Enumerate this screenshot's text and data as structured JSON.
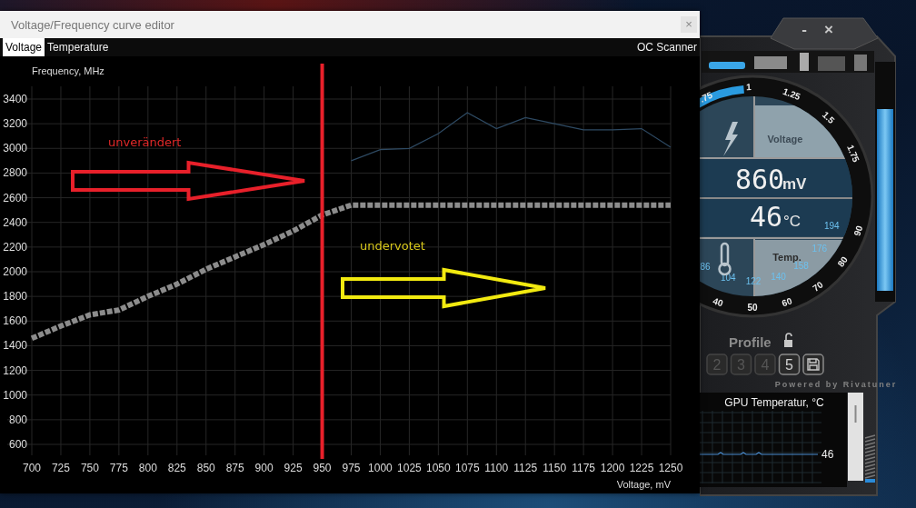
{
  "editor": {
    "title": "Voltage/Frequency curve editor",
    "close_label": "×",
    "tabs": [
      {
        "label": "Voltage",
        "selected": true
      },
      {
        "label": "Temperature",
        "selected": false
      }
    ],
    "oc_scanner": "OC Scanner",
    "chart_data": {
      "type": "line",
      "xlabel": "Voltage, mV",
      "ylabel": "Frequency, MHz",
      "x": [
        700,
        725,
        750,
        775,
        800,
        825,
        850,
        875,
        900,
        925,
        950,
        975,
        1000,
        1025,
        1050,
        1075,
        1100,
        1125,
        1150,
        1175,
        1200,
        1225,
        1250
      ],
      "series": [
        {
          "color": "#8c8c8c",
          "line_style": "dashed",
          "values": [
            1460,
            1560,
            1650,
            1690,
            1800,
            1900,
            2020,
            2120,
            2220,
            2330,
            2460,
            2540,
            2540,
            2540,
            2540,
            2540,
            2540,
            2540,
            2540,
            2540,
            2540,
            2540,
            2540
          ]
        },
        {
          "color": "#2e4a63",
          "values": [
            null,
            null,
            null,
            null,
            null,
            null,
            null,
            null,
            null,
            null,
            null,
            2900,
            2990,
            3000,
            3120,
            3290,
            3160,
            3250,
            3200,
            3150,
            3150,
            3160,
            3010
          ]
        }
      ],
      "xlim": [
        700,
        1250
      ],
      "ylim": [
        600,
        3400
      ],
      "xticks": [
        700,
        725,
        750,
        775,
        800,
        825,
        850,
        875,
        900,
        925,
        950,
        975,
        1000,
        1025,
        1050,
        1075,
        1100,
        1125,
        1150,
        1175,
        1200,
        1225,
        1250
      ],
      "yticks": [
        600,
        800,
        1000,
        1200,
        1400,
        1600,
        1800,
        2000,
        2200,
        2400,
        2600,
        2800,
        3000,
        3200,
        3400
      ],
      "grid": true,
      "ref_lines": [
        {
          "axis": "x",
          "value": 950
        }
      ],
      "annotations": [
        "unverändert",
        "undervotet"
      ]
    }
  },
  "monitor": {
    "window_buttons": [
      "-",
      "×"
    ],
    "voltage_scale": [
      ".75",
      "1",
      "1.25",
      "1.5",
      "1.75"
    ],
    "voltage_label": "Voltage",
    "voltage_value": "860",
    "voltage_unit": "mV",
    "temp_value": "46",
    "temp_unit": "°C",
    "temp_label": "Temp.",
    "fahrenheit_scale": [
      "86",
      "104",
      "122",
      "140",
      "158",
      "176",
      "194"
    ],
    "celsius_scale": [
      "40",
      "50",
      "60",
      "70",
      "80",
      "90"
    ],
    "profile_label": "Profile",
    "profiles": [
      {
        "label": "2",
        "selected": false
      },
      {
        "label": "3",
        "selected": false
      },
      {
        "label": "4",
        "selected": false
      },
      {
        "label": "5",
        "selected": true
      }
    ],
    "powered_by": "Powered by Rivatuner",
    "graph": {
      "title": "GPU Temperatur, °C",
      "reading": "46"
    }
  }
}
